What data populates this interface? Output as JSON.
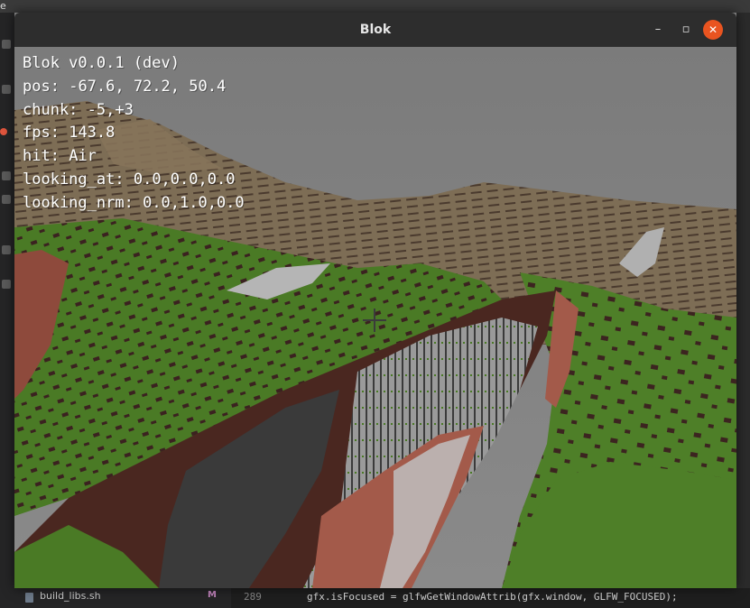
{
  "desktop": {
    "corner_letter": "e"
  },
  "editor": {
    "file_name": "build_libs.sh",
    "file_status": "M",
    "line_number": "289",
    "code_line": "gfx.isFocused = glfwGetWindowAttrib(gfx.window, GLFW_FOCUSED);"
  },
  "window": {
    "title": "Blok",
    "minimize_glyph": "–",
    "maximize_glyph": "▫",
    "close_glyph": "✕",
    "close_color": "#e95420"
  },
  "hud": {
    "version": "Blok v0.0.1 (dev)",
    "pos_label": "pos:",
    "pos_value": "-67.6, 72.2, 50.4",
    "chunk_label": "chunk:",
    "chunk_value": "-5,+3",
    "fps_label": "fps:",
    "fps_value": "143.8",
    "hit_label": "hit:",
    "hit_value": "Air",
    "looking_at_label": "looking_at:",
    "looking_at_value": "0.0,0.0,0.0",
    "looking_nrm_label": "looking_nrm:",
    "looking_nrm_value": "0.0,1.0,0.0"
  },
  "scene": {
    "sky_color": "#7d7d7d",
    "grass_color": "#4b7a26",
    "dirt_color": "#5a2d22",
    "clay_color": "#a3574a",
    "stone_color": "#a8a8a8",
    "dark_stone_color": "#3c3c3c"
  }
}
